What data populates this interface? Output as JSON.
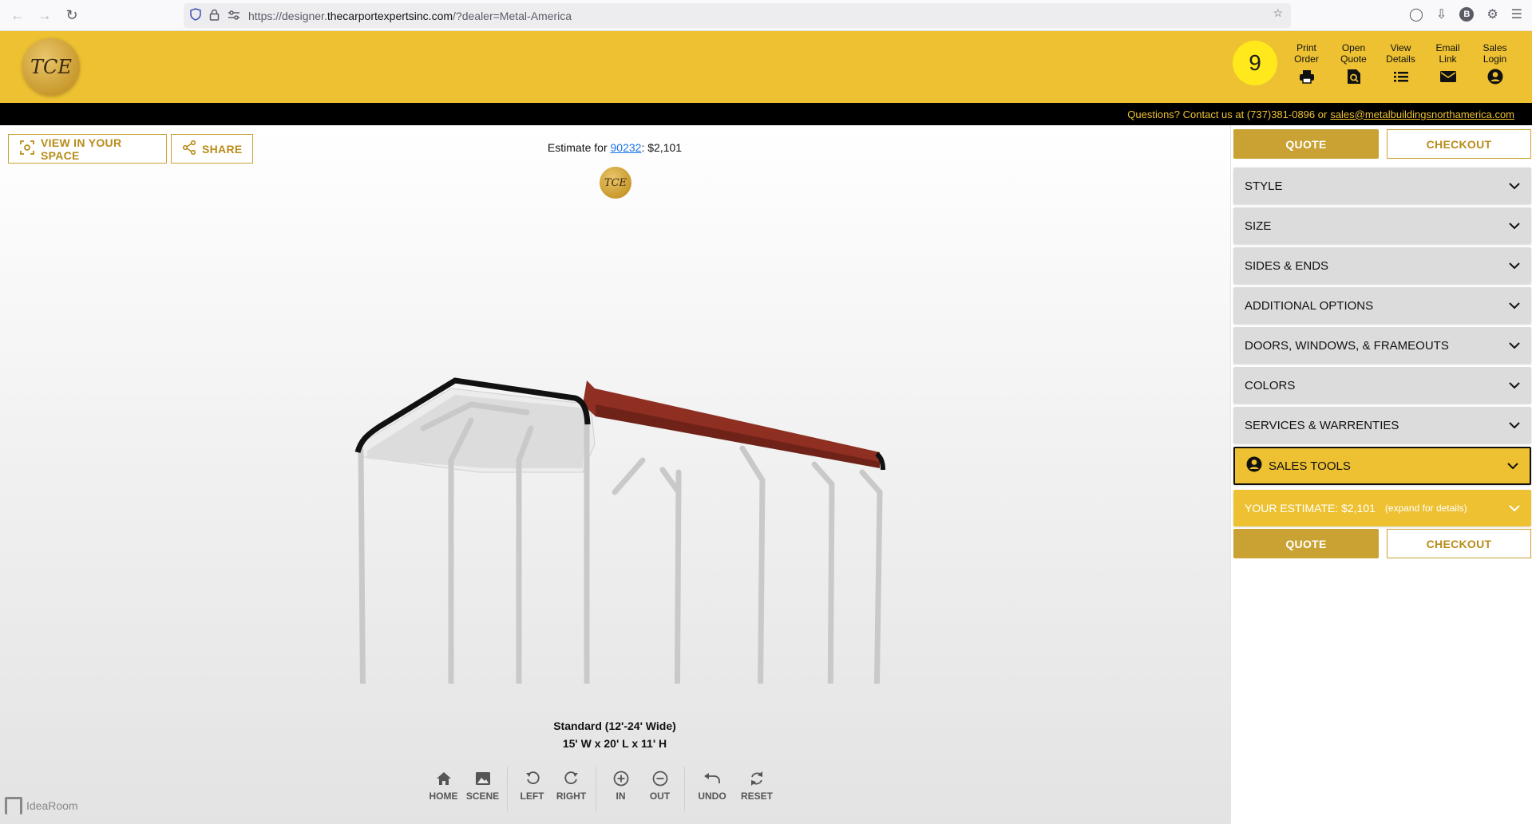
{
  "browser": {
    "url_prefix": "https://designer.",
    "url_domain": "thecarportexpertsinc.com",
    "url_path": "/?dealer=Metal-America",
    "profile_initial": "B"
  },
  "header": {
    "logo_text": "TCE",
    "notification_count": "9",
    "actions": [
      {
        "line1": "Print",
        "line2": "Order",
        "icon": "printer-icon"
      },
      {
        "line1": "Open",
        "line2": "Quote",
        "icon": "open-quote-icon"
      },
      {
        "line1": "View",
        "line2": "Details",
        "icon": "list-icon"
      },
      {
        "line1": "Email",
        "line2": "Link",
        "icon": "email-icon"
      },
      {
        "line1": "Sales",
        "line2": "Login",
        "icon": "account-icon"
      }
    ],
    "contact_text": "Questions? Contact us at (737)381-0896 or",
    "contact_email": "sales@metalbuildingsnorthamerica.com"
  },
  "viewport": {
    "view_in_space_label": "VIEW IN YOUR SPACE",
    "share_label": "SHARE",
    "estimate_prefix": "Estimate for",
    "zip": "90232",
    "estimate_price": ": $2,101",
    "caption_line1": "Standard (12'-24' Wide)",
    "caption_line2": "15' W x 20' L x 11' H",
    "brand": "IdeaRoom",
    "toolbar": {
      "home": "HOME",
      "scene": "SCENE",
      "left": "LEFT",
      "right": "RIGHT",
      "in": "IN",
      "out": "OUT",
      "undo": "UNDO",
      "reset": "RESET"
    }
  },
  "sidebar": {
    "quote_label": "QUOTE",
    "checkout_label": "CHECKOUT",
    "sections": [
      "STYLE",
      "SIZE",
      "SIDES & ENDS",
      "ADDITIONAL OPTIONS",
      "DOORS, WINDOWS, & FRAMEOUTS",
      "COLORS",
      "SERVICES & WARRENTIES"
    ],
    "sales_tools": "SALES TOOLS",
    "estimate_label": "YOUR ESTIMATE: $2,101",
    "estimate_hint": "(expand for details)"
  },
  "colors": {
    "brand_yellow": "#edc132",
    "gold": "#c9a233",
    "roof_red": "#8e2f22"
  }
}
